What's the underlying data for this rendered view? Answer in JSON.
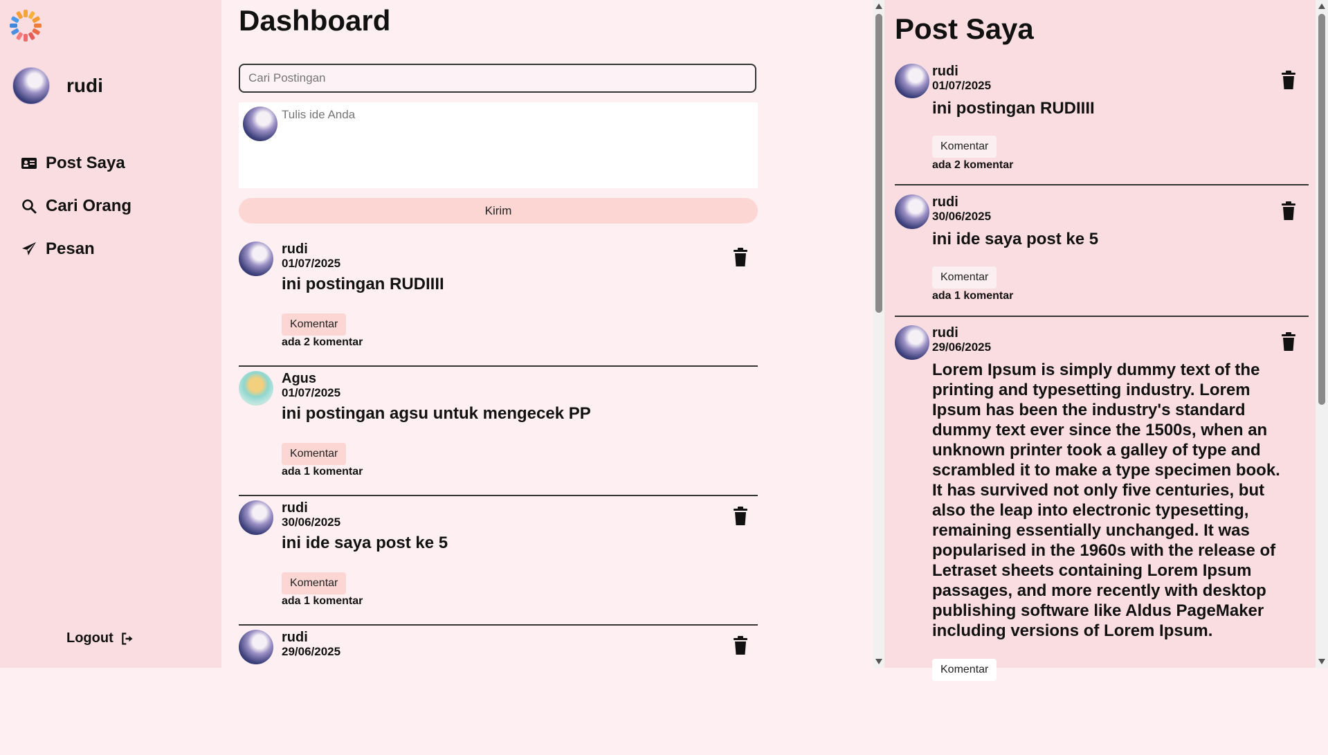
{
  "sidebar": {
    "username": "rudi",
    "nav": [
      {
        "label": "Post Saya",
        "icon": "id-card-icon"
      },
      {
        "label": "Cari Orang",
        "icon": "search-icon"
      },
      {
        "label": "Pesan",
        "icon": "paper-plane-icon"
      }
    ],
    "logout_label": "Logout"
  },
  "main": {
    "title": "Dashboard",
    "search_placeholder": "Cari Postingan",
    "composer_placeholder": "Tulis ide Anda",
    "send_label": "Kirim",
    "posts": [
      {
        "author": "rudi",
        "date": "01/07/2025",
        "text": "ini postingan RUDIIII",
        "comment_label": "Komentar",
        "comment_count": "ada 2 komentar"
      },
      {
        "author": "Agus",
        "date": "01/07/2025",
        "text": "ini postingan agsu untuk mengecek PP",
        "comment_label": "Komentar",
        "comment_count": "ada 1 komentar"
      },
      {
        "author": "rudi",
        "date": "30/06/2025",
        "text": "ini ide saya post ke 5",
        "comment_label": "Komentar",
        "comment_count": "ada 1 komentar"
      },
      {
        "author": "rudi",
        "date": "29/06/2025"
      }
    ]
  },
  "panel": {
    "title": "Post Saya",
    "posts": [
      {
        "author": "rudi",
        "date": "01/07/2025",
        "text": "ini postingan RUDIIII",
        "comment_label": "Komentar",
        "comment_count": "ada 2 komentar"
      },
      {
        "author": "rudi",
        "date": "30/06/2025",
        "text": "ini ide saya post ke 5",
        "comment_label": "Komentar",
        "comment_count": "ada 1 komentar"
      },
      {
        "author": "rudi",
        "date": "29/06/2025",
        "text": "Lorem Ipsum is simply dummy text of the printing and typesetting industry. Lorem Ipsum has been the industry's standard dummy text ever since the 1500s, when an unknown printer took a galley of type and scrambled it to make a type specimen book. It has survived not only five centuries, but also the leap into electronic typesetting, remaining essentially unchanged. It was popularised in the 1960s with the release of Letraset sheets containing Lorem Ipsum passages, and more recently with desktop publishing software like Aldus PageMaker including versions of Lorem Ipsum.",
        "comment_label": "Komentar"
      }
    ]
  },
  "colors": {
    "sidebar_bg": "#f9dde1",
    "main_bg": "#fdeff2",
    "button_pink": "#fbd6d3"
  }
}
